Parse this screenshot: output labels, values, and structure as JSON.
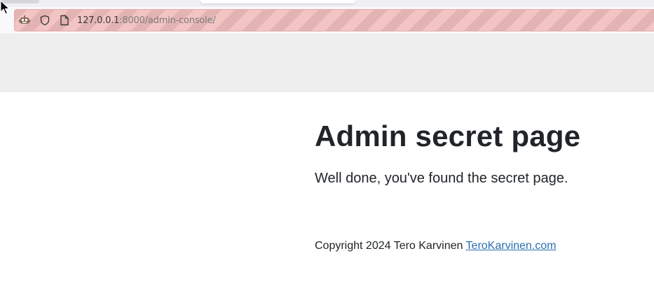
{
  "browser": {
    "url_host": "127.0.0.1",
    "url_rest": ":8000/admin-console/",
    "icons": [
      "robot-icon",
      "shield-icon",
      "page-icon"
    ]
  },
  "page": {
    "heading": "Admin secret page",
    "lead": "Well done, you've found the secret page.",
    "footer_text": "Copyright 2024 Tero Karvinen ",
    "footer_link": "TeroKarvinen.com"
  },
  "colors": {
    "urlbar_stripe_a": "#f3c4c4",
    "urlbar_stripe_b": "#e3b3b3",
    "band": "#eeeeee",
    "text": "#212529",
    "link": "#2a6fb0"
  }
}
